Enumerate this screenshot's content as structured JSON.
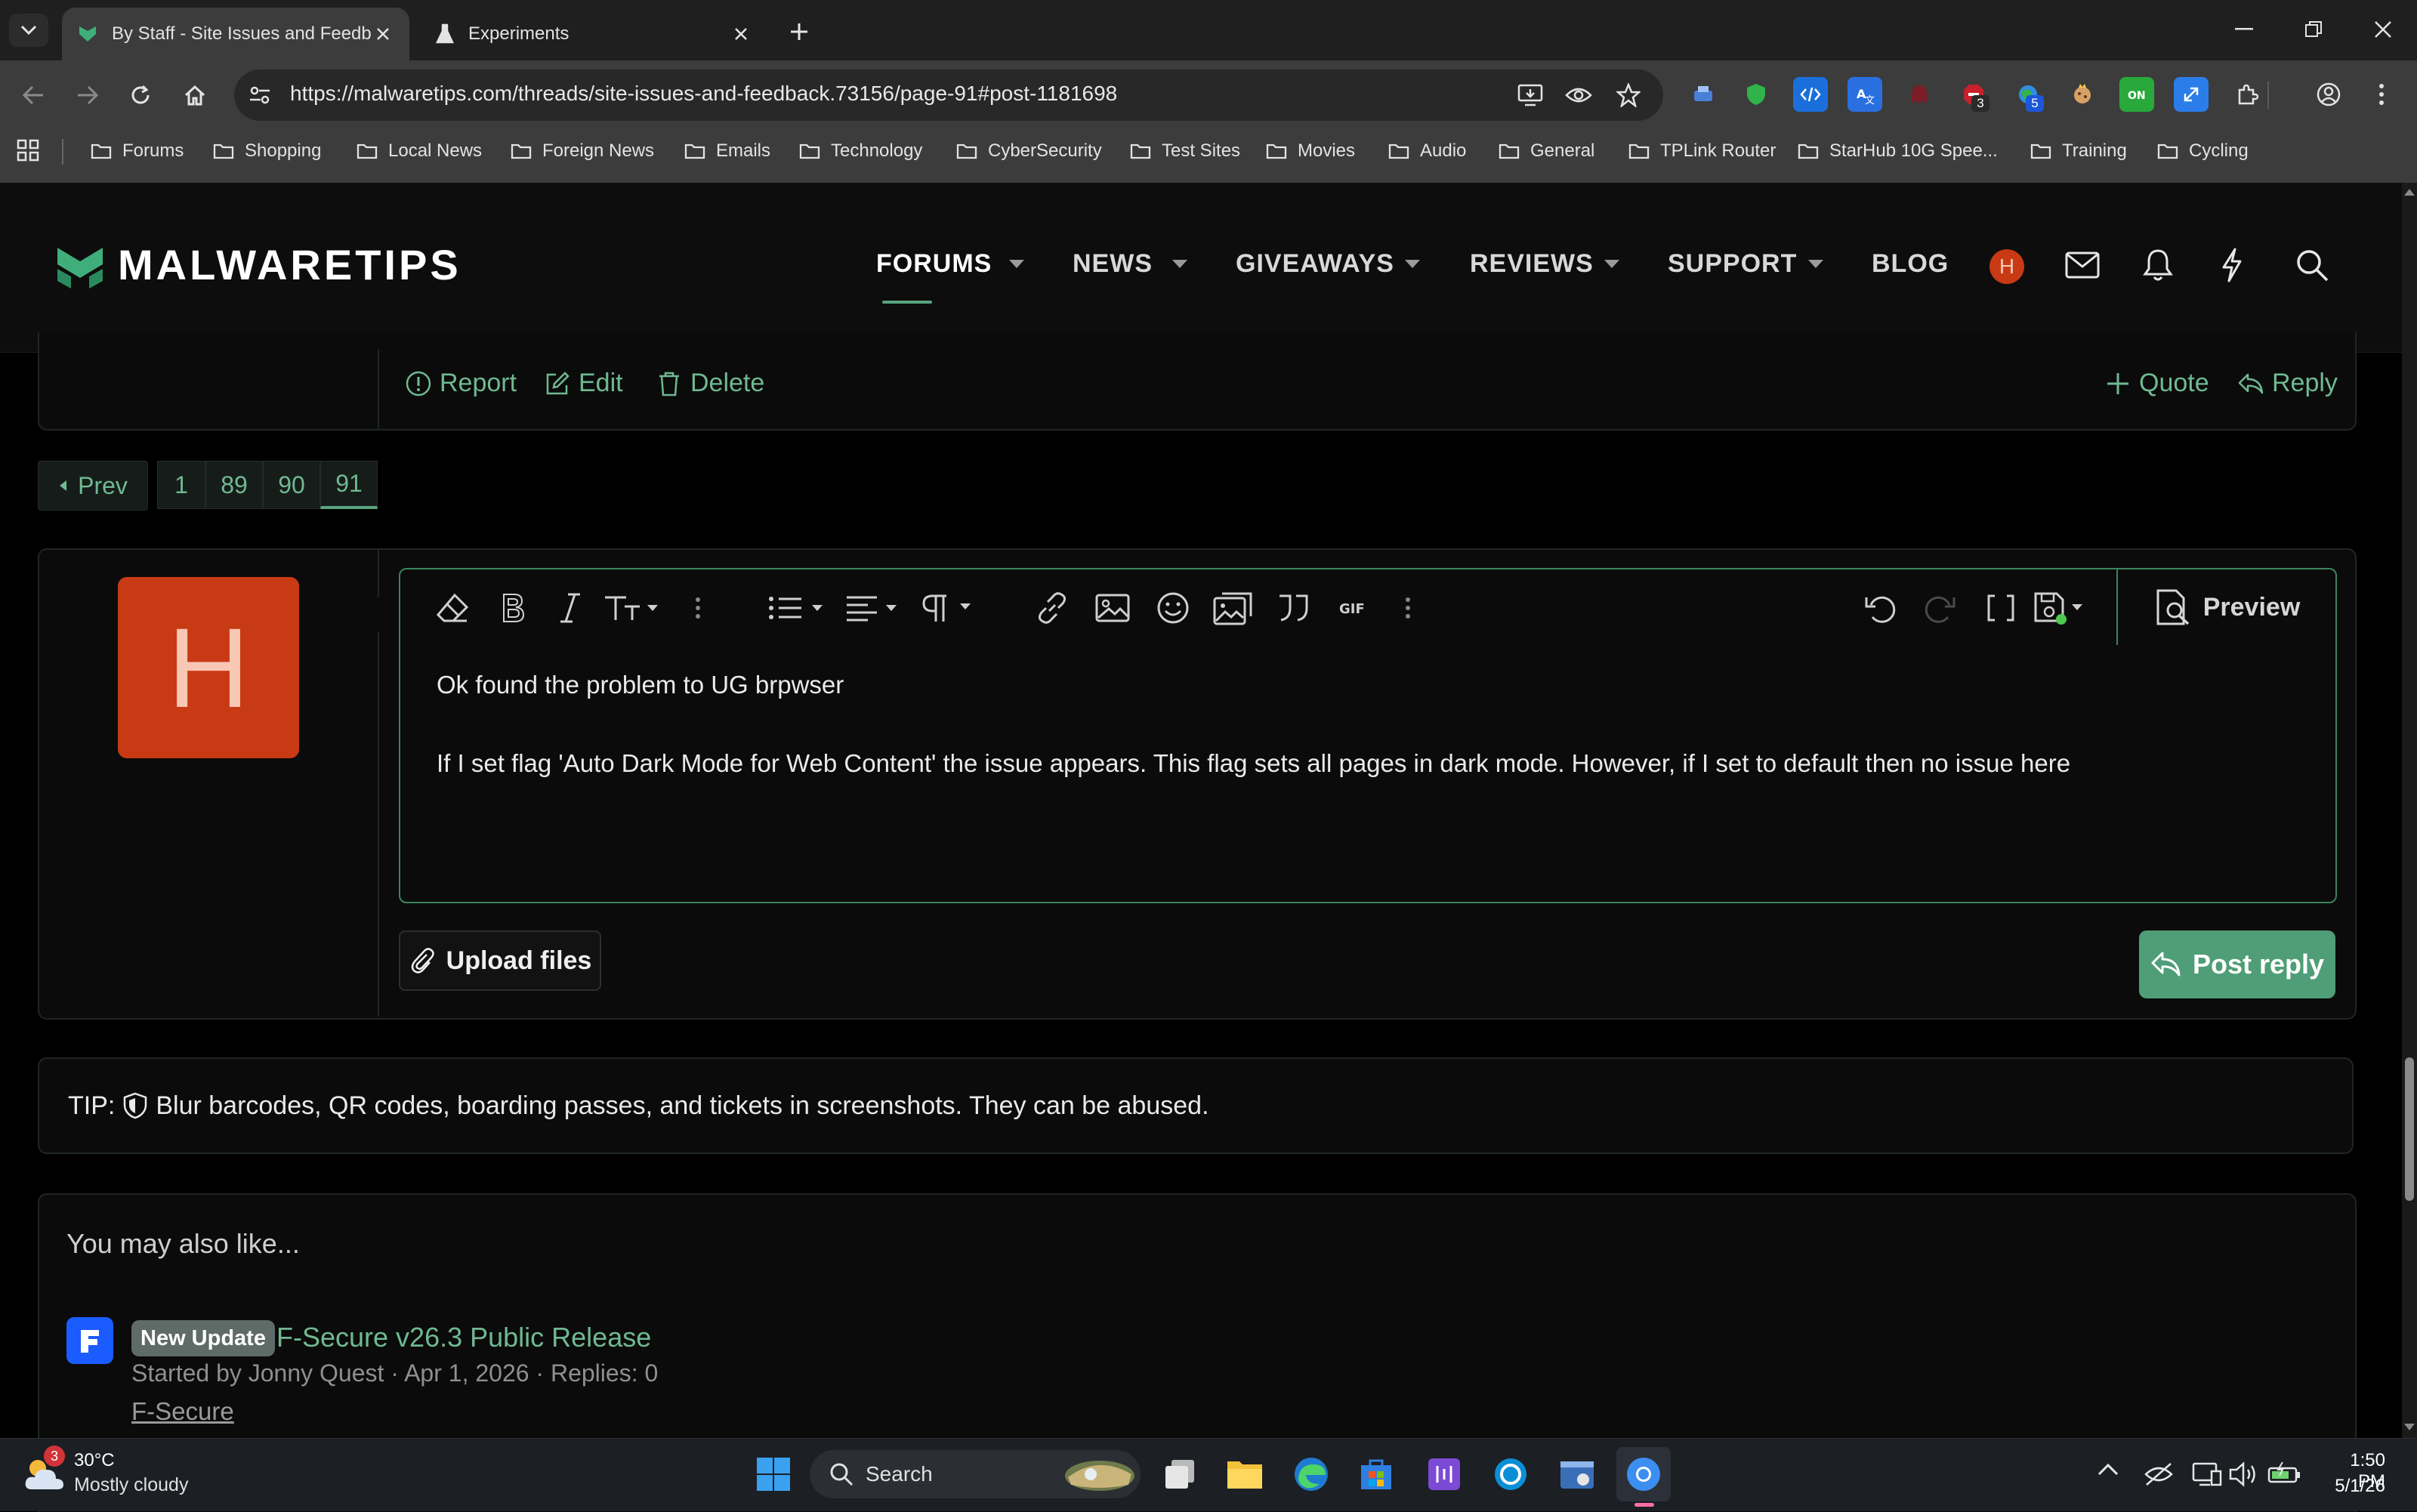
{
  "browser": {
    "tabs": [
      {
        "title": "By Staff - Site Issues and Feedb",
        "active": true
      },
      {
        "title": "Experiments",
        "active": false
      }
    ],
    "url": "https://malwaretips.com/threads/site-issues-and-feedback.73156/page-91#post-1181698",
    "bookmarks": [
      "Forums",
      "Shopping",
      "Local News",
      "Foreign News",
      "Emails",
      "Technology",
      "CyberSecurity",
      "Test Sites",
      "Movies",
      "Audio",
      "General",
      "TPLink Router",
      "StarHub 10G Spee...",
      "Training",
      "Cycling"
    ],
    "extension_badges": {
      "ext5": "3",
      "ext6": "5"
    }
  },
  "site": {
    "logo": "MALWARETIPS",
    "nav": [
      {
        "label": "FORUMS",
        "active": true
      },
      {
        "label": "NEWS"
      },
      {
        "label": "GIVEAWAYS"
      },
      {
        "label": "REVIEWS"
      },
      {
        "label": "SUPPORT"
      },
      {
        "label": "BLOG"
      }
    ],
    "user_initial": "H",
    "accent": "#57a47d"
  },
  "post_actions": {
    "report": "Report",
    "edit": "Edit",
    "delete": "Delete",
    "quote": "Quote",
    "reply": "Reply"
  },
  "pagination": {
    "prev": "Prev",
    "pages": [
      "1",
      "89",
      "90",
      "91"
    ],
    "current": "91"
  },
  "reply": {
    "avatar_letter": "H",
    "line1": "Ok found the problem to UG brpwser",
    "line2": "If I set flag 'Auto Dark Mode for Web Content' the issue appears. This flag sets all pages in dark mode. However, if I set to default then no issue here",
    "preview": "Preview",
    "upload": "Upload files",
    "post": "Post reply"
  },
  "tip": {
    "prefix": "TIP:",
    "text": "Blur barcodes, QR codes, boarding passes, and tickets in screenshots. They can be abused."
  },
  "also_like": {
    "title": "You may also like...",
    "items": [
      {
        "badge": "New Update",
        "title": "F-Secure v26.3 Public Release",
        "meta": "Started by Jonny Quest · Apr 1, 2026 · Replies: 0",
        "forum": "F-Secure"
      }
    ]
  },
  "taskbar": {
    "weather_badge": "3",
    "temp": "30°C",
    "condition": "Mostly cloudy",
    "search": "Search",
    "time": "1:50 PM",
    "date": "5/1/26"
  }
}
